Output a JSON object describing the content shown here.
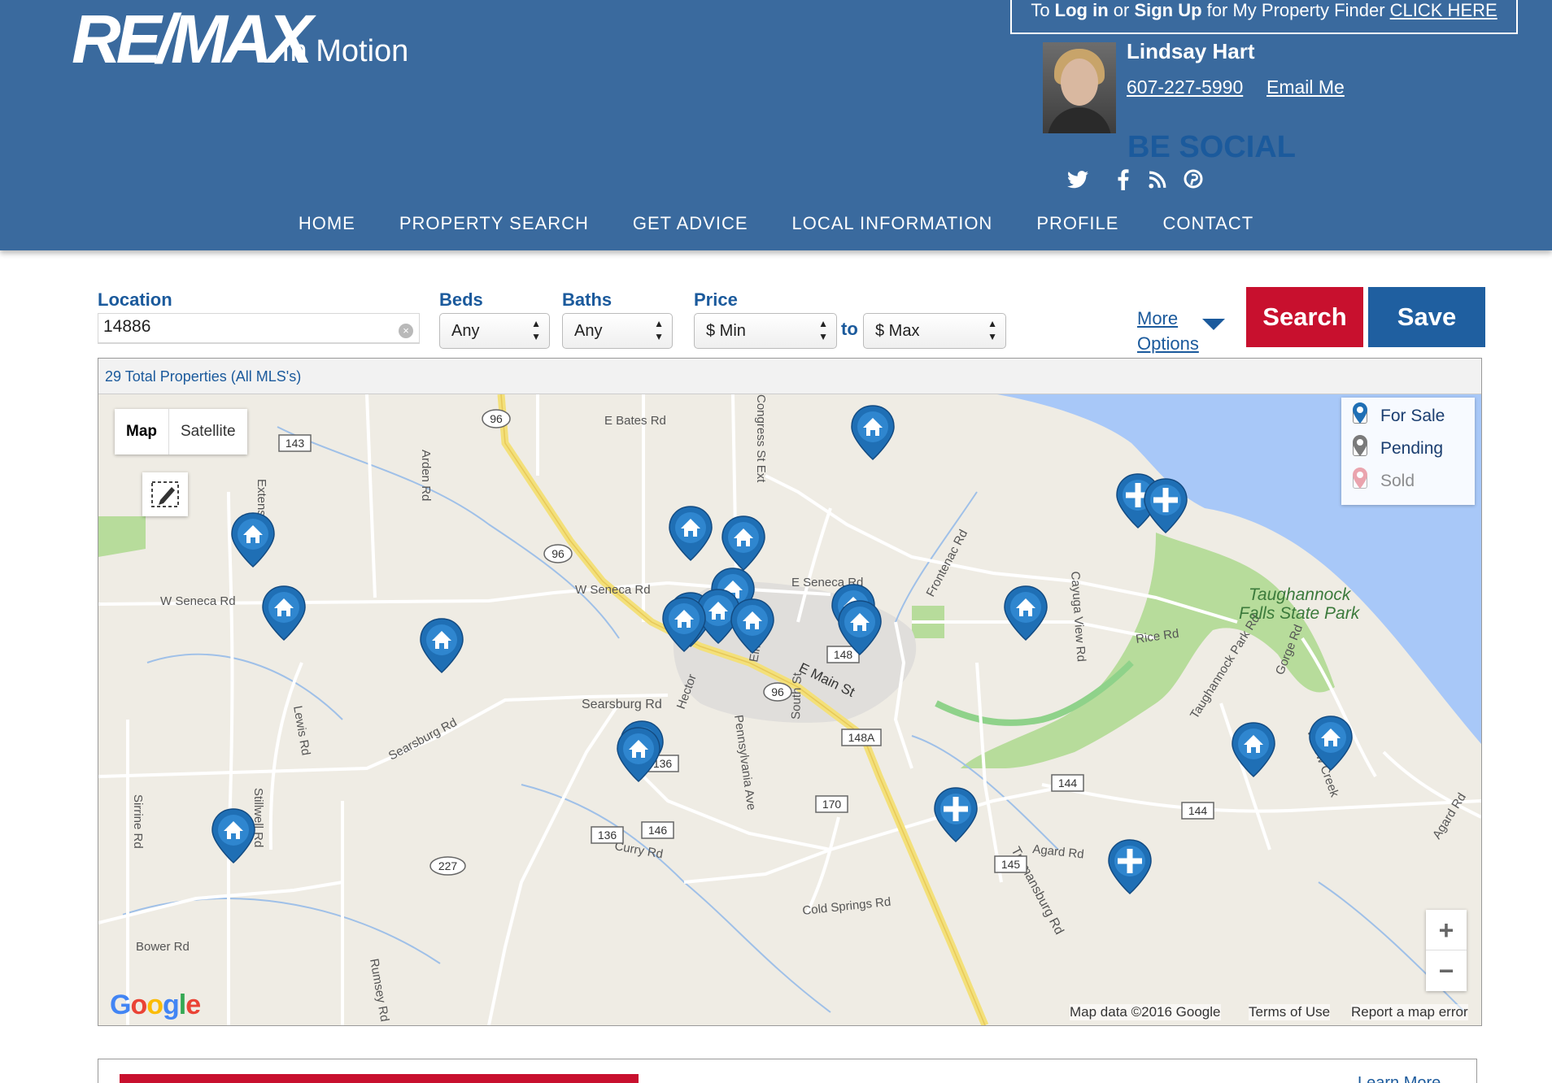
{
  "header": {
    "logo_text": "RE/MAX",
    "logo_sub": "In Motion",
    "login": {
      "prefix": "To ",
      "login": "Log in",
      "or": " or ",
      "signup": "Sign Up",
      "rest": " for My Property Finder ",
      "link": "CLICK HERE"
    },
    "agent": {
      "name": "Lindsay Hart",
      "phone": "607-227-5990",
      "email_label": "Email Me"
    },
    "be_social": "BE SOCIAL",
    "social_icons": [
      "twitter-icon",
      "facebook-icon",
      "rss-icon",
      "pinterest-icon"
    ],
    "nav": [
      "HOME",
      "PROPERTY SEARCH",
      "GET ADVICE",
      "LOCAL INFORMATION",
      "PROFILE",
      "CONTACT"
    ]
  },
  "search": {
    "location_label": "Location",
    "location_value": "14886",
    "beds_label": "Beds",
    "beds_value": "Any",
    "baths_label": "Baths",
    "baths_value": "Any",
    "price_label": "Price",
    "price_min": "$ Min",
    "price_to": "to",
    "price_max": "$ Max",
    "more_options_1": "More",
    "more_options_2": "Options",
    "search_button": "Search",
    "save_button": "Save"
  },
  "results": {
    "count_text": "29 Total Properties (All MLS's)"
  },
  "map": {
    "type_map": "Map",
    "type_satellite": "Satellite",
    "legend": [
      {
        "label": "For Sale",
        "checked": true,
        "color": "#1f6fb5"
      },
      {
        "label": "Pending",
        "checked": false,
        "color": "#7a7a7a"
      },
      {
        "label": "Sold",
        "checked": false,
        "color": "#e36c7a"
      }
    ],
    "zoom_in": "+",
    "zoom_out": "−",
    "google": "Google",
    "attribution": [
      "Map data ©2016 Google",
      "Terms of Use",
      "Report a map error"
    ],
    "road_labels": [
      "E Bates Rd",
      "W Seneca Rd",
      "W Seneca Rd",
      "E Seneca Rd",
      "Searsburg Rd",
      "Searsburg Rd",
      "Hector",
      "Pennsylvania Ave",
      "South St",
      "E Main St",
      "Rice Rd",
      "Frontenac Rd",
      "Cayuga View Rd",
      "Agard Rd",
      "Trumansburg Rd",
      "Cold Springs Rd",
      "Bower Rd",
      "Sirrine Rd",
      "Stillwell Rd",
      "Lewis Rd",
      "Arden Rd",
      "Extension",
      "Rumsey Rd",
      "Curry Rd",
      "Gorge Rd",
      "Willow Creek",
      "Taughannock Park Rd",
      "Agard Rd",
      "Congress St Ext",
      "Elm St"
    ],
    "park_label": [
      "Taughannock",
      "Falls State Park"
    ],
    "shields": [
      "96",
      "96",
      "96",
      "143",
      "148",
      "148A",
      "136",
      "136",
      "146",
      "170",
      "227",
      "144",
      "144",
      "145"
    ]
  },
  "bottom": {
    "learn_more": "Learn More"
  }
}
